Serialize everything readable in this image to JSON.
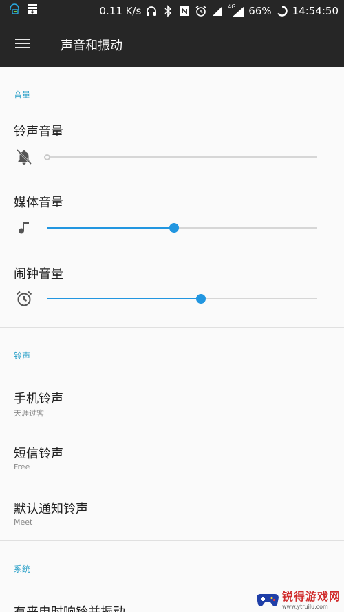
{
  "status_bar": {
    "speed": "0.11 K/s",
    "network_label": "4G",
    "battery": "66%",
    "time": "14:54:50"
  },
  "app_bar": {
    "title": "声音和振动"
  },
  "volume": {
    "section_title": "音量",
    "ringtone": {
      "label": "铃声音量",
      "level": 0.0
    },
    "media": {
      "label": "媒体音量",
      "level": 0.47
    },
    "alarm": {
      "label": "闹钟音量",
      "level": 0.57
    }
  },
  "ringtones": {
    "section_title": "铃声",
    "items": [
      {
        "title": "手机铃声",
        "subtitle": "天涯过客"
      },
      {
        "title": "短信铃声",
        "subtitle": "Free"
      },
      {
        "title": "默认通知铃声",
        "subtitle": "Meet"
      }
    ]
  },
  "system": {
    "section_title": "系统",
    "items": [
      {
        "title": "有来电时响铃并振动"
      }
    ]
  },
  "watermark": {
    "name": "锐得游戏网",
    "url": "www.ytruilu.com"
  },
  "colors": {
    "accent": "#2296e0",
    "section_header": "#2aa0c8",
    "bar": "#262626"
  }
}
